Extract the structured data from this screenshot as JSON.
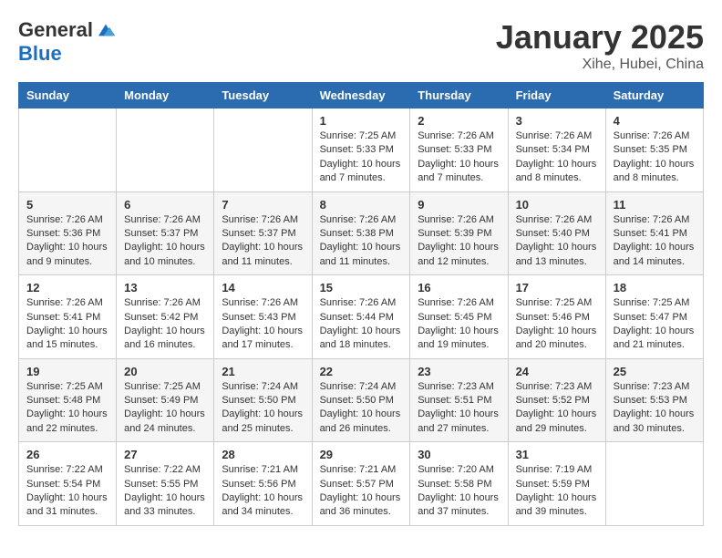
{
  "logo": {
    "general": "General",
    "blue": "Blue"
  },
  "header": {
    "month": "January 2025",
    "location": "Xihe, Hubei, China"
  },
  "weekdays": [
    "Sunday",
    "Monday",
    "Tuesday",
    "Wednesday",
    "Thursday",
    "Friday",
    "Saturday"
  ],
  "weeks": [
    [
      {
        "day": "",
        "sunrise": "",
        "sunset": "",
        "daylight": ""
      },
      {
        "day": "",
        "sunrise": "",
        "sunset": "",
        "daylight": ""
      },
      {
        "day": "",
        "sunrise": "",
        "sunset": "",
        "daylight": ""
      },
      {
        "day": "1",
        "sunrise": "Sunrise: 7:25 AM",
        "sunset": "Sunset: 5:33 PM",
        "daylight": "Daylight: 10 hours and 7 minutes."
      },
      {
        "day": "2",
        "sunrise": "Sunrise: 7:26 AM",
        "sunset": "Sunset: 5:33 PM",
        "daylight": "Daylight: 10 hours and 7 minutes."
      },
      {
        "day": "3",
        "sunrise": "Sunrise: 7:26 AM",
        "sunset": "Sunset: 5:34 PM",
        "daylight": "Daylight: 10 hours and 8 minutes."
      },
      {
        "day": "4",
        "sunrise": "Sunrise: 7:26 AM",
        "sunset": "Sunset: 5:35 PM",
        "daylight": "Daylight: 10 hours and 8 minutes."
      }
    ],
    [
      {
        "day": "5",
        "sunrise": "Sunrise: 7:26 AM",
        "sunset": "Sunset: 5:36 PM",
        "daylight": "Daylight: 10 hours and 9 minutes."
      },
      {
        "day": "6",
        "sunrise": "Sunrise: 7:26 AM",
        "sunset": "Sunset: 5:37 PM",
        "daylight": "Daylight: 10 hours and 10 minutes."
      },
      {
        "day": "7",
        "sunrise": "Sunrise: 7:26 AM",
        "sunset": "Sunset: 5:37 PM",
        "daylight": "Daylight: 10 hours and 11 minutes."
      },
      {
        "day": "8",
        "sunrise": "Sunrise: 7:26 AM",
        "sunset": "Sunset: 5:38 PM",
        "daylight": "Daylight: 10 hours and 11 minutes."
      },
      {
        "day": "9",
        "sunrise": "Sunrise: 7:26 AM",
        "sunset": "Sunset: 5:39 PM",
        "daylight": "Daylight: 10 hours and 12 minutes."
      },
      {
        "day": "10",
        "sunrise": "Sunrise: 7:26 AM",
        "sunset": "Sunset: 5:40 PM",
        "daylight": "Daylight: 10 hours and 13 minutes."
      },
      {
        "day": "11",
        "sunrise": "Sunrise: 7:26 AM",
        "sunset": "Sunset: 5:41 PM",
        "daylight": "Daylight: 10 hours and 14 minutes."
      }
    ],
    [
      {
        "day": "12",
        "sunrise": "Sunrise: 7:26 AM",
        "sunset": "Sunset: 5:41 PM",
        "daylight": "Daylight: 10 hours and 15 minutes."
      },
      {
        "day": "13",
        "sunrise": "Sunrise: 7:26 AM",
        "sunset": "Sunset: 5:42 PM",
        "daylight": "Daylight: 10 hours and 16 minutes."
      },
      {
        "day": "14",
        "sunrise": "Sunrise: 7:26 AM",
        "sunset": "Sunset: 5:43 PM",
        "daylight": "Daylight: 10 hours and 17 minutes."
      },
      {
        "day": "15",
        "sunrise": "Sunrise: 7:26 AM",
        "sunset": "Sunset: 5:44 PM",
        "daylight": "Daylight: 10 hours and 18 minutes."
      },
      {
        "day": "16",
        "sunrise": "Sunrise: 7:26 AM",
        "sunset": "Sunset: 5:45 PM",
        "daylight": "Daylight: 10 hours and 19 minutes."
      },
      {
        "day": "17",
        "sunrise": "Sunrise: 7:25 AM",
        "sunset": "Sunset: 5:46 PM",
        "daylight": "Daylight: 10 hours and 20 minutes."
      },
      {
        "day": "18",
        "sunrise": "Sunrise: 7:25 AM",
        "sunset": "Sunset: 5:47 PM",
        "daylight": "Daylight: 10 hours and 21 minutes."
      }
    ],
    [
      {
        "day": "19",
        "sunrise": "Sunrise: 7:25 AM",
        "sunset": "Sunset: 5:48 PM",
        "daylight": "Daylight: 10 hours and 22 minutes."
      },
      {
        "day": "20",
        "sunrise": "Sunrise: 7:25 AM",
        "sunset": "Sunset: 5:49 PM",
        "daylight": "Daylight: 10 hours and 24 minutes."
      },
      {
        "day": "21",
        "sunrise": "Sunrise: 7:24 AM",
        "sunset": "Sunset: 5:50 PM",
        "daylight": "Daylight: 10 hours and 25 minutes."
      },
      {
        "day": "22",
        "sunrise": "Sunrise: 7:24 AM",
        "sunset": "Sunset: 5:50 PM",
        "daylight": "Daylight: 10 hours and 26 minutes."
      },
      {
        "day": "23",
        "sunrise": "Sunrise: 7:23 AM",
        "sunset": "Sunset: 5:51 PM",
        "daylight": "Daylight: 10 hours and 27 minutes."
      },
      {
        "day": "24",
        "sunrise": "Sunrise: 7:23 AM",
        "sunset": "Sunset: 5:52 PM",
        "daylight": "Daylight: 10 hours and 29 minutes."
      },
      {
        "day": "25",
        "sunrise": "Sunrise: 7:23 AM",
        "sunset": "Sunset: 5:53 PM",
        "daylight": "Daylight: 10 hours and 30 minutes."
      }
    ],
    [
      {
        "day": "26",
        "sunrise": "Sunrise: 7:22 AM",
        "sunset": "Sunset: 5:54 PM",
        "daylight": "Daylight: 10 hours and 31 minutes."
      },
      {
        "day": "27",
        "sunrise": "Sunrise: 7:22 AM",
        "sunset": "Sunset: 5:55 PM",
        "daylight": "Daylight: 10 hours and 33 minutes."
      },
      {
        "day": "28",
        "sunrise": "Sunrise: 7:21 AM",
        "sunset": "Sunset: 5:56 PM",
        "daylight": "Daylight: 10 hours and 34 minutes."
      },
      {
        "day": "29",
        "sunrise": "Sunrise: 7:21 AM",
        "sunset": "Sunset: 5:57 PM",
        "daylight": "Daylight: 10 hours and 36 minutes."
      },
      {
        "day": "30",
        "sunrise": "Sunrise: 7:20 AM",
        "sunset": "Sunset: 5:58 PM",
        "daylight": "Daylight: 10 hours and 37 minutes."
      },
      {
        "day": "31",
        "sunrise": "Sunrise: 7:19 AM",
        "sunset": "Sunset: 5:59 PM",
        "daylight": "Daylight: 10 hours and 39 minutes."
      },
      {
        "day": "",
        "sunrise": "",
        "sunset": "",
        "daylight": ""
      }
    ]
  ]
}
